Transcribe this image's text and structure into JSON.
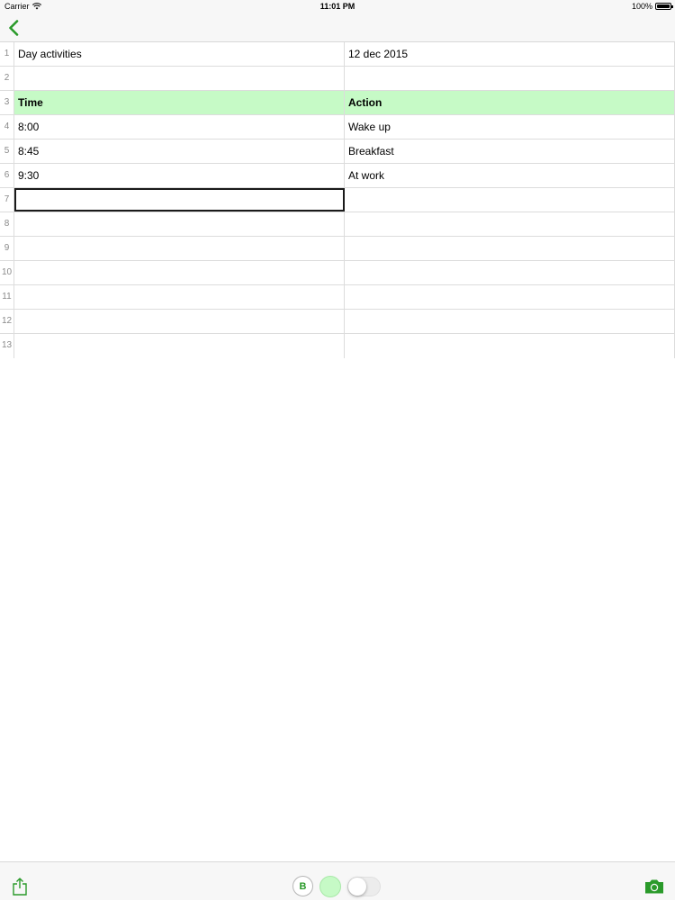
{
  "status_bar": {
    "carrier": "Carrier",
    "time": "11:01 PM",
    "battery": "100%",
    "battery_level": 1.0,
    "wifi_icon": "wifi-icon",
    "battery_icon": "battery-icon"
  },
  "nav": {
    "back_icon": "chevron-left-icon"
  },
  "colors": {
    "accent": "#2a9a2a",
    "header_fill": "#c6fac6",
    "grid_line": "#dcdcdc"
  },
  "grid": {
    "rows": [
      {
        "num": "1",
        "a": "Day activities",
        "b": "12 dec 2015"
      },
      {
        "num": "2",
        "a": "",
        "b": ""
      },
      {
        "num": "3",
        "a": "Time",
        "b": "Action"
      },
      {
        "num": "4",
        "a": "8:00",
        "b": "Wake up"
      },
      {
        "num": "5",
        "a": "8:45",
        "b": "Breakfast"
      },
      {
        "num": "6",
        "a": "9:30",
        "b": "At work"
      },
      {
        "num": "7",
        "a": "",
        "b": ""
      },
      {
        "num": "8",
        "a": "",
        "b": ""
      },
      {
        "num": "9",
        "a": "",
        "b": ""
      },
      {
        "num": "10",
        "a": "",
        "b": ""
      },
      {
        "num": "11",
        "a": "",
        "b": ""
      },
      {
        "num": "12",
        "a": "",
        "b": ""
      },
      {
        "num": "13",
        "a": "",
        "b": ""
      }
    ]
  },
  "toolbar": {
    "share_icon": "share-icon",
    "bold_label": "B",
    "camera_icon": "camera-icon"
  }
}
